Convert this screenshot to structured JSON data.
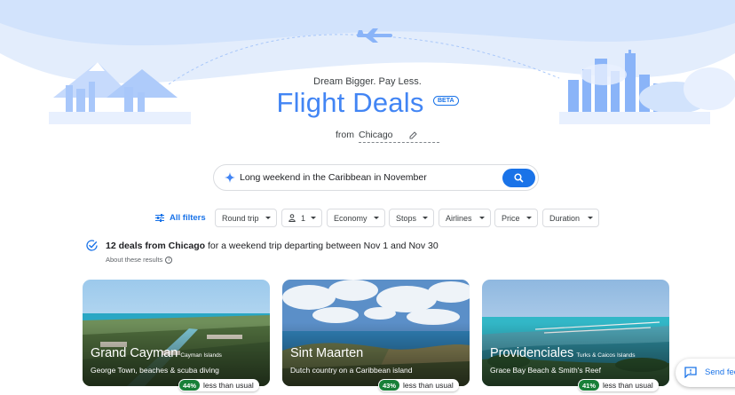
{
  "hero": {
    "tagline": "Dream Bigger. Pay Less.",
    "title": "Flight Deals",
    "badge": "BETA",
    "from_label": "from",
    "from_city": "Chicago"
  },
  "search": {
    "query": "Long weekend in the Caribbean in November"
  },
  "filters": {
    "all_filters": "All filters",
    "chips": [
      {
        "label": "Round trip"
      },
      {
        "label": "1"
      },
      {
        "label": "Economy"
      },
      {
        "label": "Stops"
      },
      {
        "label": "Airlines"
      },
      {
        "label": "Price"
      },
      {
        "label": "Duration"
      }
    ]
  },
  "results": {
    "count_text": "12 deals from Chicago",
    "rest_text": " for a weekend trip departing between Nov 1 and Nov 30",
    "about": "About these results"
  },
  "cards": [
    {
      "name": "Grand Cayman",
      "country": "Cayman Islands",
      "description": "George Town, beaches & scuba diving",
      "discount": "44%",
      "discount_text": "less than usual"
    },
    {
      "name": "Sint Maarten",
      "country": "",
      "description": "Dutch country on a Caribbean island",
      "discount": "43%",
      "discount_text": "less than usual"
    },
    {
      "name": "Providenciales",
      "country": "Turks & Caicos Islands",
      "description": "Grace Bay Beach & Smith's Reef",
      "discount": "41%",
      "discount_text": "less than usual"
    }
  ],
  "feedback": {
    "label": "Send feedback"
  },
  "colors": {
    "accent": "#1a73e8",
    "title_blue": "#4285f4",
    "deal_green": "#188038",
    "hero_blue": "#dbe8fb"
  }
}
